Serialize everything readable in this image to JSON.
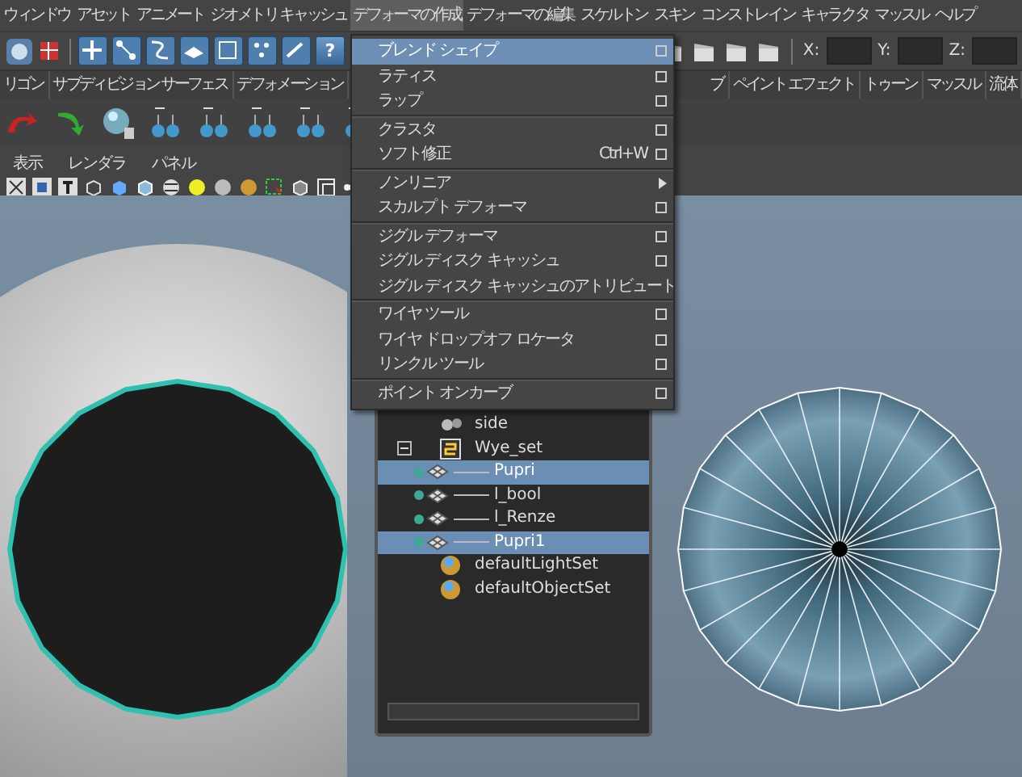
{
  "menubar": [
    {
      "label": "ウィンドウ",
      "selected": false
    },
    {
      "label": "アセット",
      "selected": false
    },
    {
      "label": "アニメート",
      "selected": false
    },
    {
      "label": "ジオメトリ キャッシュ",
      "selected": false
    },
    {
      "label": "デフォーマの作成",
      "selected": true
    },
    {
      "label": "デフォーマの編集",
      "selected": false
    },
    {
      "label": "スケルトン",
      "selected": false
    },
    {
      "label": "スキン",
      "selected": false
    },
    {
      "label": "コンストレイン",
      "selected": false
    },
    {
      "label": "キャラクタ",
      "selected": false
    },
    {
      "label": "マッスル",
      "selected": false
    },
    {
      "label": "ヘルプ",
      "selected": false
    }
  ],
  "toolbar": {
    "help_label": "?",
    "coords": [
      {
        "label": "X:"
      },
      {
        "label": "Y:"
      },
      {
        "label": "Z:"
      }
    ]
  },
  "shelf_tabs_left": [
    {
      "label": "リゴン",
      "selected": false
    },
    {
      "label": "サブディビジョン サーフェス",
      "selected": false
    },
    {
      "label": "デフォメーション",
      "selected": false
    }
  ],
  "shelf_tabs_right": [
    {
      "label": "ブ",
      "selected": false
    },
    {
      "label": "ペイント エフェクト",
      "selected": false
    },
    {
      "label": "トゥーン",
      "selected": false
    },
    {
      "label": "マッスル",
      "selected": false
    },
    {
      "label": "流体",
      "selected": false
    }
  ],
  "panel_menu": [
    "表示",
    "レンダラ",
    "パネル"
  ],
  "dropdown": [
    {
      "label": "ブレンド シェイプ",
      "selected": true,
      "option_box": true,
      "submenu": false,
      "separator_before": false
    },
    {
      "label": "ラティス",
      "selected": false,
      "option_box": true,
      "submenu": false,
      "separator_before": false
    },
    {
      "label": "ラップ",
      "selected": false,
      "option_box": true,
      "submenu": false,
      "separator_before": false
    },
    {
      "label": "クラスタ",
      "selected": false,
      "option_box": true,
      "submenu": false,
      "separator_before": true
    },
    {
      "label": "ソフト修正",
      "shortcut": "Ctrl+W",
      "selected": false,
      "option_box": true,
      "submenu": false,
      "separator_before": false
    },
    {
      "label": "ノンリニア",
      "selected": false,
      "option_box": false,
      "submenu": true,
      "separator_before": true
    },
    {
      "label": "スカルプト デフォーマ",
      "selected": false,
      "option_box": true,
      "submenu": false,
      "separator_before": false
    },
    {
      "label": "ジグル デフォーマ",
      "selected": false,
      "option_box": true,
      "submenu": false,
      "separator_before": true
    },
    {
      "label": "ジグル ディスク キャッシュ",
      "selected": false,
      "option_box": true,
      "submenu": false,
      "separator_before": false
    },
    {
      "label": "ジグル ディスク キャッシュのアトリビュート",
      "selected": false,
      "option_box": false,
      "submenu": false,
      "separator_before": false
    },
    {
      "label": "ワイヤ ツール",
      "selected": false,
      "option_box": true,
      "submenu": false,
      "separator_before": true
    },
    {
      "label": "ワイヤ ドロップオフ ロケータ",
      "selected": false,
      "option_box": true,
      "submenu": false,
      "separator_before": false
    },
    {
      "label": "リンクル ツール",
      "selected": false,
      "option_box": true,
      "submenu": false,
      "separator_before": false
    },
    {
      "label": "ポイント オンカーブ",
      "selected": false,
      "option_box": true,
      "submenu": false,
      "separator_before": true
    }
  ],
  "outliner": [
    {
      "label": "side",
      "kind": "camera",
      "selected": false
    },
    {
      "label": "Wye_set",
      "kind": "set",
      "selected": false,
      "expanded": true,
      "children": [
        {
          "label": "Pupri",
          "kind": "mesh",
          "selected": true
        },
        {
          "label": "l_bool",
          "kind": "mesh",
          "selected": false
        },
        {
          "label": "l_Renze",
          "kind": "mesh",
          "selected": false
        },
        {
          "label": "Pupri1",
          "kind": "mesh",
          "selected": true
        }
      ]
    },
    {
      "label": "defaultLightSet",
      "kind": "default-set",
      "selected": false
    },
    {
      "label": "defaultObjectSet",
      "kind": "default-set",
      "selected": false
    }
  ]
}
